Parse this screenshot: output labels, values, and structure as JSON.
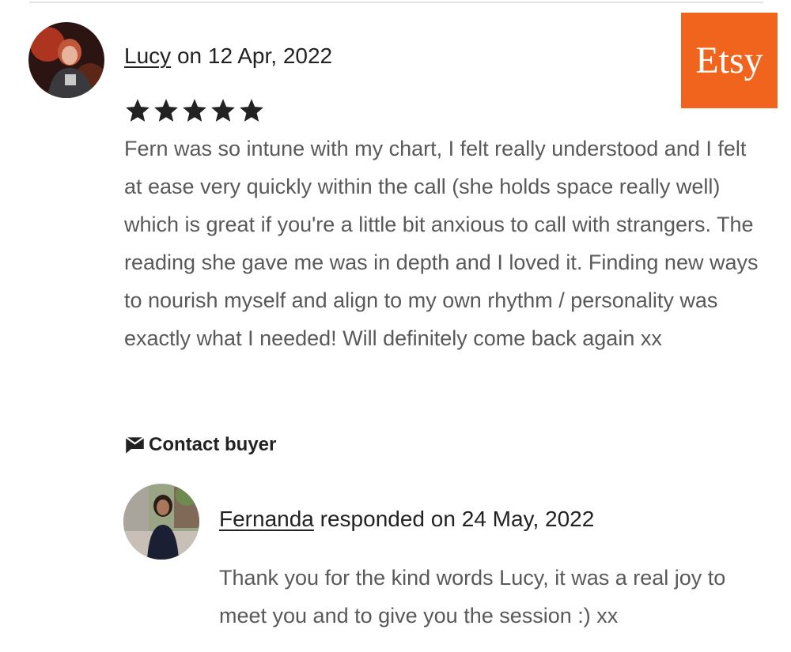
{
  "review": {
    "reviewer_name": "Lucy",
    "date_prefix": "on",
    "date": "12 Apr, 2022",
    "rating": 5,
    "rating_max": 5,
    "text": "Fern was so intune with my chart, I felt really understood and I felt at ease very quickly within the call (she holds space really well) which is great if you're a little bit anxious to call with strangers. The reading she gave me was in depth and I loved it. Finding new ways to nourish myself and align to my own rhythm / personality was exactly what I needed! Will definitely come back again xx"
  },
  "actions": {
    "contact_buyer_label": "Contact buyer",
    "contact_icon": "mail-icon"
  },
  "response": {
    "seller_name": "Fernanda",
    "responded_prefix": "responded on",
    "date": "24 May, 2022",
    "text": "Thank you for the kind words Lucy, it was a real joy to meet you and to give you the session :) xx"
  },
  "logo": {
    "text": "Etsy",
    "background": "#f1641e"
  },
  "colors": {
    "star": "#222222",
    "body_text": "#595959",
    "heading_text": "#222222"
  }
}
